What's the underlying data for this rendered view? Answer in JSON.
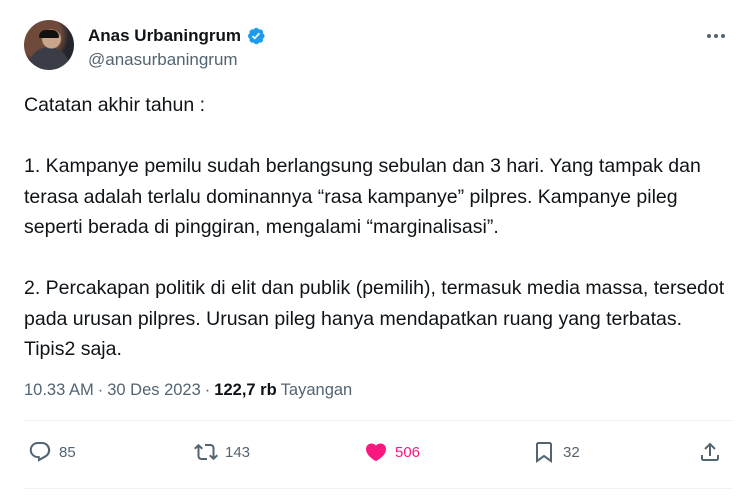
{
  "author": {
    "name": "Anas Urbaningrum",
    "handle": "@anasurbaningrum",
    "verified": true
  },
  "tweet": {
    "paragraphs": [
      "Catatan akhir tahun :",
      "1. Kampanye pemilu sudah berlangsung sebulan dan 3 hari. Yang tampak dan terasa adalah terlalu dominannya “rasa kampanye” pilpres. Kampanye pileg seperti berada di pinggiran, mengalami “marginalisasi”.",
      "2. Percakapan politik di elit dan publik (pemilih), termasuk media massa, tersedot pada urusan pilpres. Urusan pileg hanya mendapatkan ruang yang terbatas. Tipis2 saja."
    ],
    "time": "10.33 AM",
    "separator": "·",
    "date": "30 Des 2023",
    "views_count": "122,7 rb",
    "views_label": "Tayangan"
  },
  "actions": {
    "replies": "85",
    "reposts": "143",
    "likes": "506",
    "bookmarks": "32"
  },
  "colors": {
    "text": "#0f1419",
    "secondary": "#536471",
    "verified": "#1d9bf0",
    "like": "#f91880",
    "divider": "#eff3f4"
  },
  "icons": [
    "more-icon",
    "verified-badge-icon",
    "reply-icon",
    "repost-icon",
    "heart-filled-icon",
    "bookmark-icon",
    "share-icon"
  ]
}
